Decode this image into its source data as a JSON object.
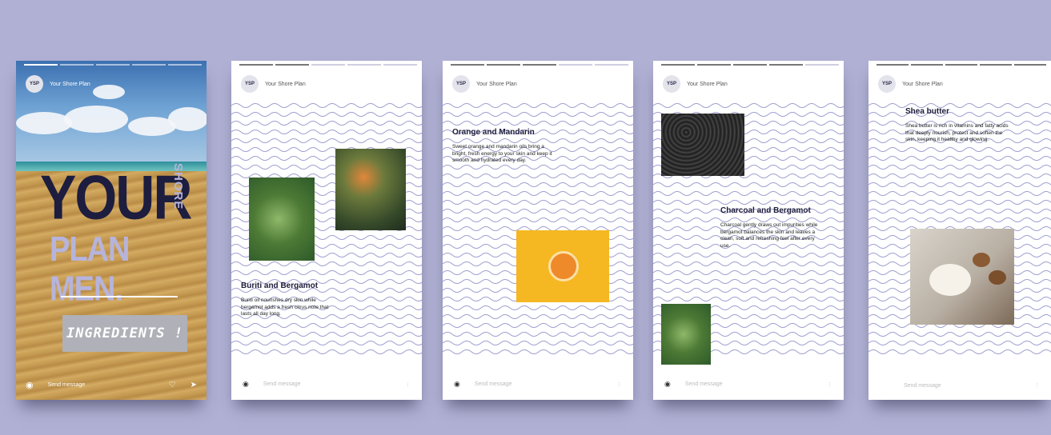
{
  "colors": {
    "background": "#b0b0d4",
    "navy": "#1d1d3f",
    "lavender": "#b6b4dc",
    "wave": "#9e9ed0",
    "orange_tile": "#f5b822"
  },
  "stories": [
    {
      "username": "Your Shore Plan",
      "headline_1": "YOUR",
      "headline_vertical": "SHORE",
      "headline_2": "PLAN MEN.",
      "button_label": "INGREDIENTS !",
      "reply_placeholder": "Send message",
      "icons": [
        "camera-icon",
        "heart-icon",
        "send-icon"
      ]
    },
    {
      "username": "Your Shore Plan",
      "title": "Buriti and Bergamot",
      "body": "Buriti oil nourishes dry skin while bergamot adds a fresh citrus note that lasts all day long.",
      "reply_placeholder": "Send message",
      "icons": [
        "camera-icon",
        "more-icon"
      ]
    },
    {
      "username": "Your Shore Plan",
      "title": "Orange and Mandarin",
      "body": "Sweet orange and mandarin oils bring a bright, fresh energy to your skin and keep it smooth and hydrated every day.",
      "reply_placeholder": "Send message",
      "icons": [
        "camera-icon",
        "more-icon"
      ]
    },
    {
      "username": "Your Shore Plan",
      "title": "Charcoal and Bergamot",
      "body": "Charcoal gently draws out impurities while bergamot balances the skin and leaves a clean, soft and refreshing feel after every use.",
      "reply_placeholder": "Send message",
      "icons": [
        "camera-icon",
        "more-icon"
      ]
    },
    {
      "username": "Your Shore Plan",
      "title": "Shea butter",
      "body": "Shea butter is rich in vitamins and fatty acids that deeply nourish, protect and soften the skin, keeping it healthy and glowing.",
      "reply_placeholder": "Send message",
      "icons": [
        "more-icon"
      ]
    }
  ]
}
